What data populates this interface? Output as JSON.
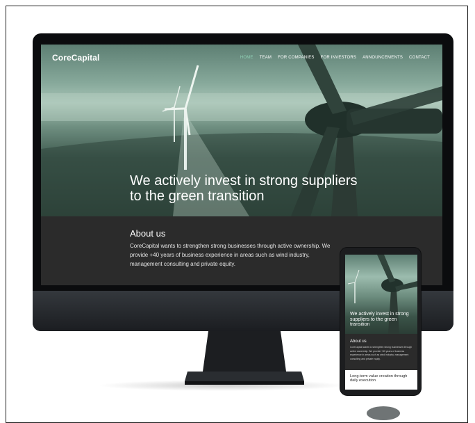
{
  "site": {
    "brand": "CoreCapital",
    "nav": [
      {
        "label": "HOME",
        "active": true
      },
      {
        "label": "TEAM",
        "active": false
      },
      {
        "label": "FOR COMPANIES",
        "active": false
      },
      {
        "label": "FOR INVESTORS",
        "active": false
      },
      {
        "label": "ANNOUNCEMENTS",
        "active": false
      },
      {
        "label": "CONTACT",
        "active": false
      }
    ],
    "hero_title": "We actively invest in strong suppliers to the green transition",
    "about": {
      "title": "About us",
      "text": "CoreCapital wants to strengthen strong businesses through active ownership. We provide +40 years of business experience in areas such as wind industry, management consulting and private equity."
    }
  },
  "mobile": {
    "hero_title": "We actively invest in strong suppliers to the green transition",
    "about_title": "About us",
    "about_text": "CoreCapital wants to strengthen strong businesses through active ownership. We provide +40 years of business experience in areas such as wind industry, management consulting and private equity.",
    "value_title": "Long-term value creation through daily execution"
  },
  "colors": {
    "accent": "#8fd1b5",
    "section_dark": "#2b2b2b",
    "device_frame": "#0b0c0e"
  }
}
